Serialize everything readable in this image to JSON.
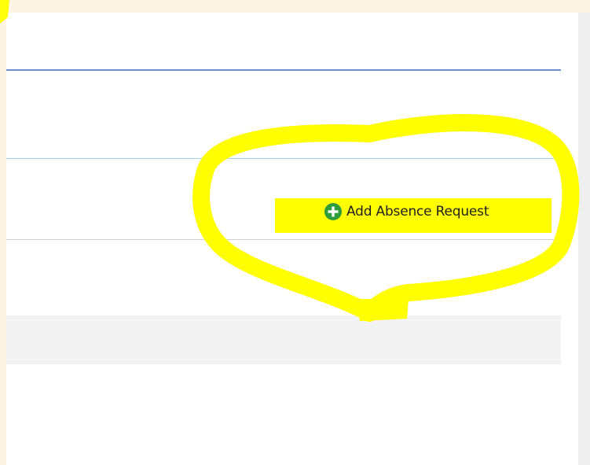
{
  "actions": {
    "add_absence_request_label": "Add Absence Request",
    "add_icon": "plus-circle-icon"
  },
  "colors": {
    "page_background": "#fdf4e5",
    "panel_background": "#ffffff",
    "divider_primary": "#6c8ec9",
    "divider_secondary": "#a9d0ef",
    "divider_tertiary": "#cfcfcf",
    "band_background": "#f3f3f3",
    "highlight": "#ffff00",
    "icon_green": "#2e9b3c"
  }
}
